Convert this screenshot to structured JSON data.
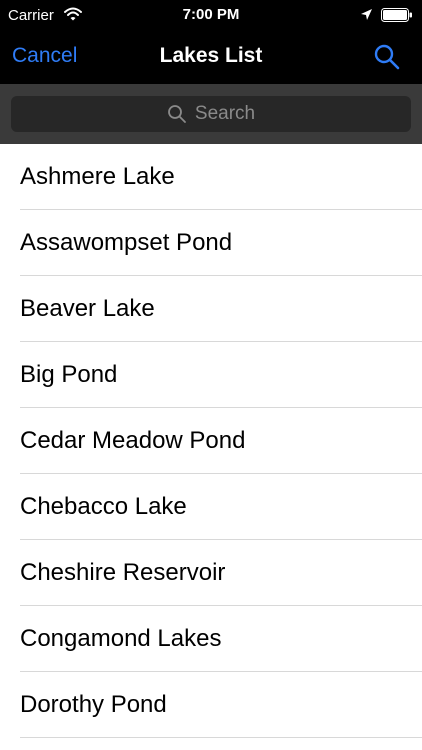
{
  "status_bar": {
    "carrier": "Carrier",
    "time": "7:00 PM"
  },
  "nav": {
    "cancel_label": "Cancel",
    "title": "Lakes List",
    "search_icon": "search-icon"
  },
  "search": {
    "placeholder": "Search"
  },
  "lakes": [
    "Ashmere Lake",
    "Assawompset Pond",
    "Beaver Lake",
    "Big Pond",
    "Cedar Meadow Pond",
    "Chebacco Lake",
    "Cheshire Reservoir",
    "Congamond Lakes",
    "Dorothy Pond"
  ],
  "colors": {
    "accent": "#2f7cf6",
    "bar_background": "#000000",
    "search_bar_background": "#3a3a3a"
  }
}
